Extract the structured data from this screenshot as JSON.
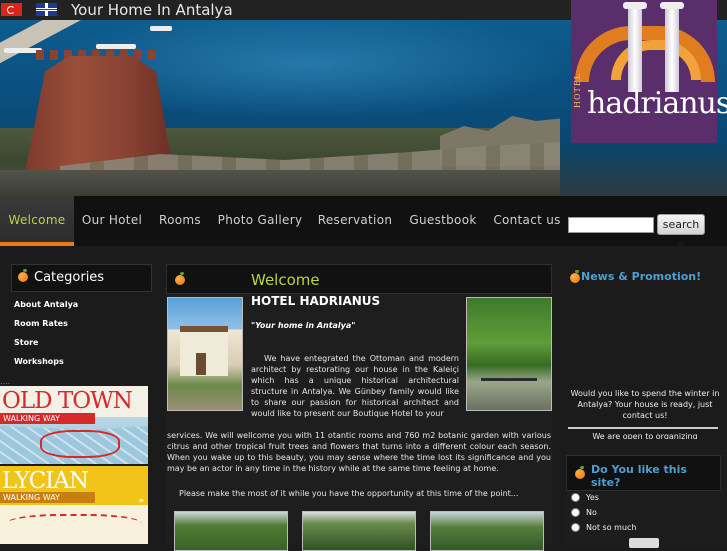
{
  "header": {
    "tagline": "Your Home In Antalya",
    "flags": [
      "turkish-flag-icon",
      "uk-flag-icon"
    ]
  },
  "logo": {
    "small": "HOTEL",
    "name": "hadrianus"
  },
  "nav": {
    "items": [
      {
        "label": "Welcome",
        "active": true
      },
      {
        "label": "Our Hotel"
      },
      {
        "label": "Rooms"
      },
      {
        "label": "Photo Gallery"
      },
      {
        "label": "Reservation"
      },
      {
        "label": "Guestbook"
      },
      {
        "label": "Contact us"
      }
    ],
    "search_value": "",
    "search_button": "search »"
  },
  "sidebar": {
    "title": "Categories",
    "links": [
      "About Antalya",
      "Room Rates",
      "Store",
      "Workshops"
    ],
    "dots": "....",
    "promos": [
      {
        "title": "OLD TOWN",
        "subtitle": "WALKING WAY"
      },
      {
        "title": "LYCIAN",
        "subtitle": "WALKING WAY",
        "arrow": "»"
      }
    ]
  },
  "main": {
    "section_title": "Welcome",
    "hotel_name": "HOTEL HADRIANUS",
    "quote": "\"Your home in Antalya\"",
    "para1": "We have entegrated the Ottoman and modern architect by restorating our house in the Kaleiçi which has a unique historical architectural structure in Antalya. We Günbey family would like to share our passion for historical architect and would like to present our Boutique Hotel to your",
    "para2": "services. We will wellcome you with 11 otantic rooms and 760 m2 botanic garden with various citrus and other tropical fruit trees and flowers that turns into a different colour each season. When you wake up to this beauty, you may sense where the time lost its significance and you may be an actor in any time in the history while at the same time feeling at home.",
    "para3": "Please make the most of it while you have the opportunity at this time of the point..."
  },
  "news": {
    "title": "News & Promotion!",
    "text": "Would you like to spend the winter in Antalya? Your house is ready, just contact us!",
    "more": "We are open to organizing"
  },
  "poll": {
    "title": "Do You like this site?",
    "options": [
      "Yes",
      "No",
      "Not so much"
    ]
  },
  "colors": {
    "accent_green": "#b7d640",
    "accent_orange": "#e87b17",
    "link_blue": "#4d9fd1",
    "logo_purple": "#5a2d6b"
  }
}
